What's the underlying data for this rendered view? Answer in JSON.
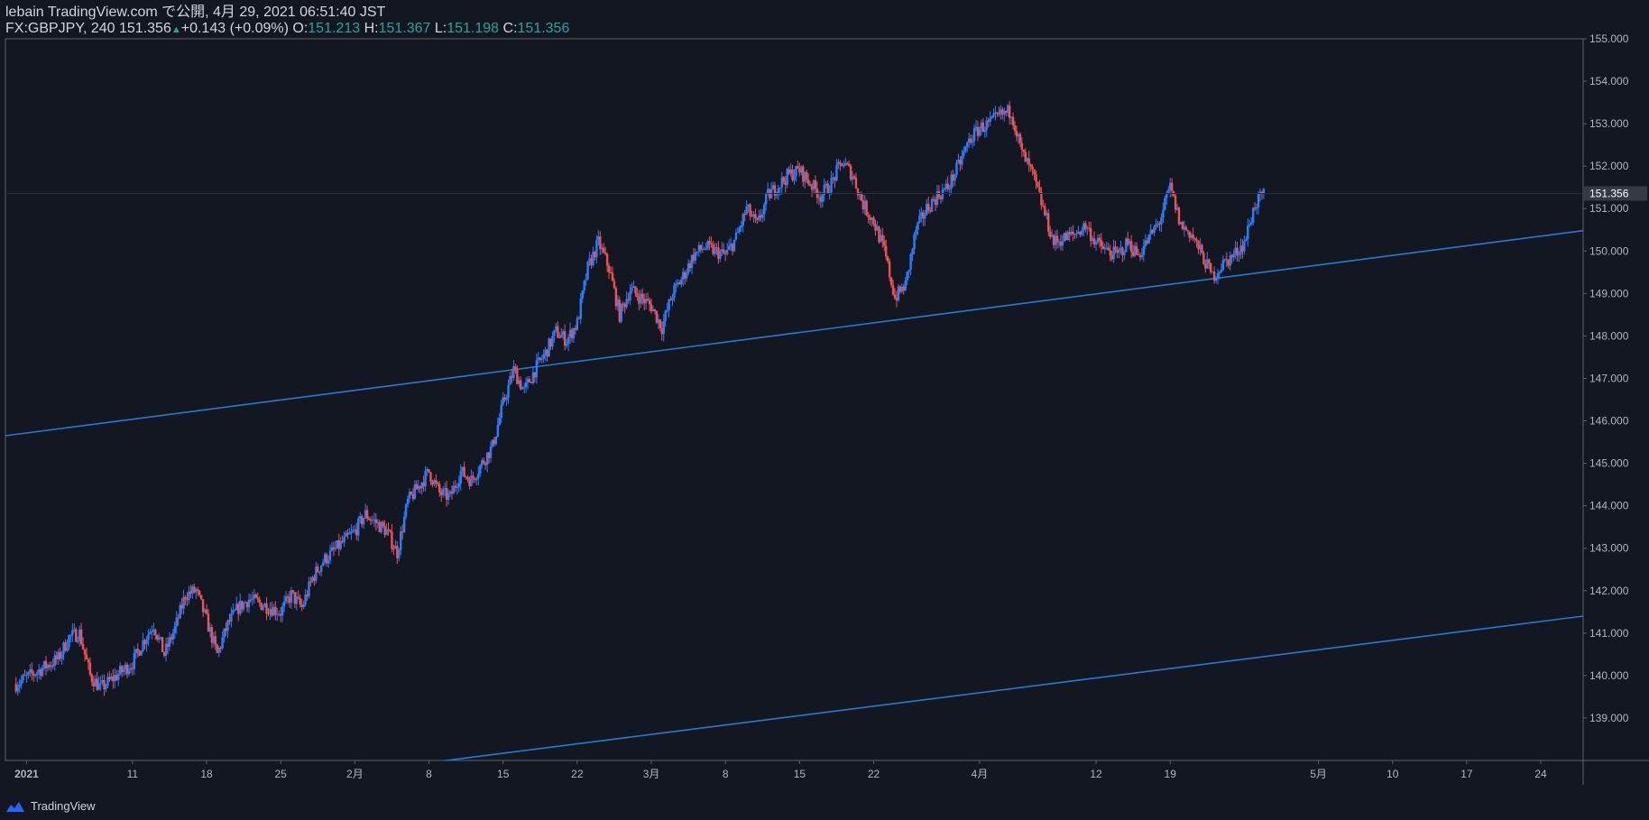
{
  "header": {
    "line1": "lebain TradingView.com で公開, 4月 29, 2021 06:51:40 JST",
    "symbol_interval": "FX:GBPJPY, 240",
    "last": "151.356",
    "change": "+0.143 (+0.09%)",
    "o_label": "O:",
    "o_value": "151.213",
    "h_label": "H:",
    "h_value": "151.367",
    "l_label": "L:",
    "l_value": "151.198",
    "c_label": "C:",
    "c_value": "151.356"
  },
  "footer": {
    "brand": "TradingView",
    "logo_icon": "tradingview-logo-icon"
  },
  "colors": {
    "bg": "#131722",
    "up": "#2a7fff",
    "down": "#ef5350",
    "trend": "#2679d8",
    "axis_text": "#b2b5be",
    "border": "#5d606b",
    "label_bg": "#363a45"
  },
  "chart_data": {
    "type": "candlestick",
    "symbol": "FX:GBPJPY",
    "interval": "240",
    "ylim": [
      138.0,
      155.0
    ],
    "y_ticks": [
      155.0,
      154.0,
      153.0,
      152.0,
      151.0,
      150.0,
      149.0,
      148.0,
      147.0,
      146.0,
      145.0,
      144.0,
      143.0,
      142.0,
      141.0,
      140.0,
      139.0
    ],
    "y_tick_labels": [
      "155.000",
      "154.000",
      "153.000",
      "152.000",
      "151.000",
      "150.000",
      "149.000",
      "148.000",
      "147.000",
      "146.000",
      "145.000",
      "144.000",
      "143.000",
      "142.000",
      "141.000",
      "140.000",
      "139.000"
    ],
    "x_range": [
      "2020-12-30",
      "2021-05-28"
    ],
    "x_ticks": [
      {
        "label": "2021",
        "date": "2021-01-01",
        "bold": true
      },
      {
        "label": "11",
        "date": "2021-01-11"
      },
      {
        "label": "18",
        "date": "2021-01-18"
      },
      {
        "label": "25",
        "date": "2021-01-25"
      },
      {
        "label": "2月",
        "date": "2021-02-01"
      },
      {
        "label": "8",
        "date": "2021-02-08"
      },
      {
        "label": "15",
        "date": "2021-02-15"
      },
      {
        "label": "22",
        "date": "2021-02-22"
      },
      {
        "label": "3月",
        "date": "2021-03-01"
      },
      {
        "label": "8",
        "date": "2021-03-08"
      },
      {
        "label": "15",
        "date": "2021-03-15"
      },
      {
        "label": "22",
        "date": "2021-03-22"
      },
      {
        "label": "4月",
        "date": "2021-04-01"
      },
      {
        "label": "12",
        "date": "2021-04-12"
      },
      {
        "label": "19",
        "date": "2021-04-19"
      },
      {
        "label": "5月",
        "date": "2021-05-03"
      },
      {
        "label": "10",
        "date": "2021-05-10"
      },
      {
        "label": "17",
        "date": "2021-05-17"
      },
      {
        "label": "24",
        "date": "2021-05-24"
      }
    ],
    "last_price": 151.356,
    "last_price_label": "151.356",
    "price_path": [
      [
        "2020-12-31",
        139.8
      ],
      [
        "2021-01-04",
        140.4
      ],
      [
        "2021-01-05",
        140.9
      ],
      [
        "2021-01-06",
        141.0
      ],
      [
        "2021-01-07",
        140.0
      ],
      [
        "2021-01-08",
        139.7
      ],
      [
        "2021-01-11",
        140.3
      ],
      [
        "2021-01-12",
        140.8
      ],
      [
        "2021-01-13",
        141.2
      ],
      [
        "2021-01-14",
        140.5
      ],
      [
        "2021-01-15",
        141.1
      ],
      [
        "2021-01-16",
        141.9
      ],
      [
        "2021-01-17",
        142.0
      ],
      [
        "2021-01-18",
        141.3
      ],
      [
        "2021-01-19",
        140.5
      ],
      [
        "2021-01-20",
        141.2
      ],
      [
        "2021-01-21",
        141.6
      ],
      [
        "2021-01-22",
        141.8
      ],
      [
        "2021-01-25",
        141.5
      ],
      [
        "2021-01-26",
        141.9
      ],
      [
        "2021-01-27",
        141.6
      ],
      [
        "2021-01-28",
        142.3
      ],
      [
        "2021-01-29",
        142.7
      ],
      [
        "2021-02-01",
        143.4
      ],
      [
        "2021-02-02",
        143.8
      ],
      [
        "2021-02-03",
        143.6
      ],
      [
        "2021-02-04",
        143.4
      ],
      [
        "2021-02-05",
        142.9
      ],
      [
        "2021-02-06",
        144.1
      ],
      [
        "2021-02-08",
        144.8
      ],
      [
        "2021-02-09",
        144.3
      ],
      [
        "2021-02-10",
        144.2
      ],
      [
        "2021-02-11",
        144.8
      ],
      [
        "2021-02-12",
        144.6
      ],
      [
        "2021-02-14",
        145.4
      ],
      [
        "2021-02-15",
        146.4
      ],
      [
        "2021-02-16",
        147.2
      ],
      [
        "2021-02-17",
        146.7
      ],
      [
        "2021-02-18",
        147.2
      ],
      [
        "2021-02-19",
        147.6
      ],
      [
        "2021-02-20",
        148.1
      ],
      [
        "2021-02-21",
        147.9
      ],
      [
        "2021-02-22",
        148.3
      ],
      [
        "2021-02-23",
        149.6
      ],
      [
        "2021-02-24",
        150.2
      ],
      [
        "2021-02-25",
        149.6
      ],
      [
        "2021-02-26",
        148.5
      ],
      [
        "2021-02-27",
        149.1
      ],
      [
        "2021-03-01",
        148.7
      ],
      [
        "2021-03-02",
        148.2
      ],
      [
        "2021-03-03",
        149.0
      ],
      [
        "2021-03-04",
        149.4
      ],
      [
        "2021-03-05",
        149.9
      ],
      [
        "2021-03-06",
        150.1
      ],
      [
        "2021-03-08",
        149.9
      ],
      [
        "2021-03-09",
        150.3
      ],
      [
        "2021-03-10",
        151.0
      ],
      [
        "2021-03-11",
        150.6
      ],
      [
        "2021-03-12",
        151.3
      ],
      [
        "2021-03-14",
        151.8
      ],
      [
        "2021-03-15",
        151.9
      ],
      [
        "2021-03-16",
        151.6
      ],
      [
        "2021-03-17",
        151.3
      ],
      [
        "2021-03-18",
        151.6
      ],
      [
        "2021-03-19",
        152.1
      ],
      [
        "2021-03-20",
        151.8
      ],
      [
        "2021-03-21",
        151.1
      ],
      [
        "2021-03-22",
        150.7
      ],
      [
        "2021-03-23",
        150.0
      ],
      [
        "2021-03-24",
        148.9
      ],
      [
        "2021-03-25",
        149.2
      ],
      [
        "2021-03-26",
        150.5
      ],
      [
        "2021-03-27",
        151.0
      ],
      [
        "2021-03-28",
        151.3
      ],
      [
        "2021-03-29",
        151.5
      ],
      [
        "2021-03-30",
        152.0
      ],
      [
        "2021-03-31",
        152.6
      ],
      [
        "2021-04-01",
        152.9
      ],
      [
        "2021-04-02",
        153.0
      ],
      [
        "2021-04-03",
        153.2
      ],
      [
        "2021-04-04",
        153.3
      ],
      [
        "2021-04-05",
        152.3
      ],
      [
        "2021-04-06",
        151.8
      ],
      [
        "2021-04-07",
        151.0
      ],
      [
        "2021-04-08",
        150.2
      ],
      [
        "2021-04-09",
        150.3
      ],
      [
        "2021-04-10",
        150.4
      ],
      [
        "2021-04-11",
        150.6
      ],
      [
        "2021-04-12",
        150.2
      ],
      [
        "2021-04-13",
        150.0
      ],
      [
        "2021-04-14",
        149.9
      ],
      [
        "2021-04-15",
        150.2
      ],
      [
        "2021-04-16",
        149.9
      ],
      [
        "2021-04-17",
        150.3
      ],
      [
        "2021-04-18",
        150.7
      ],
      [
        "2021-04-19",
        151.5
      ],
      [
        "2021-04-20",
        150.6
      ],
      [
        "2021-04-21",
        150.4
      ],
      [
        "2021-04-22",
        149.9
      ],
      [
        "2021-04-23",
        149.4
      ],
      [
        "2021-04-24",
        149.7
      ],
      [
        "2021-04-25",
        149.9
      ],
      [
        "2021-04-26",
        150.2
      ],
      [
        "2021-04-27",
        151.1
      ],
      [
        "2021-04-28",
        151.356
      ]
    ],
    "trend_lines": [
      {
        "from": [
          "2020-12-30",
          145.65
        ],
        "to": [
          "2021-05-28",
          150.48
        ]
      },
      {
        "from": [
          "2020-12-30",
          136.68
        ],
        "to": [
          "2021-05-28",
          141.4
        ]
      }
    ]
  }
}
